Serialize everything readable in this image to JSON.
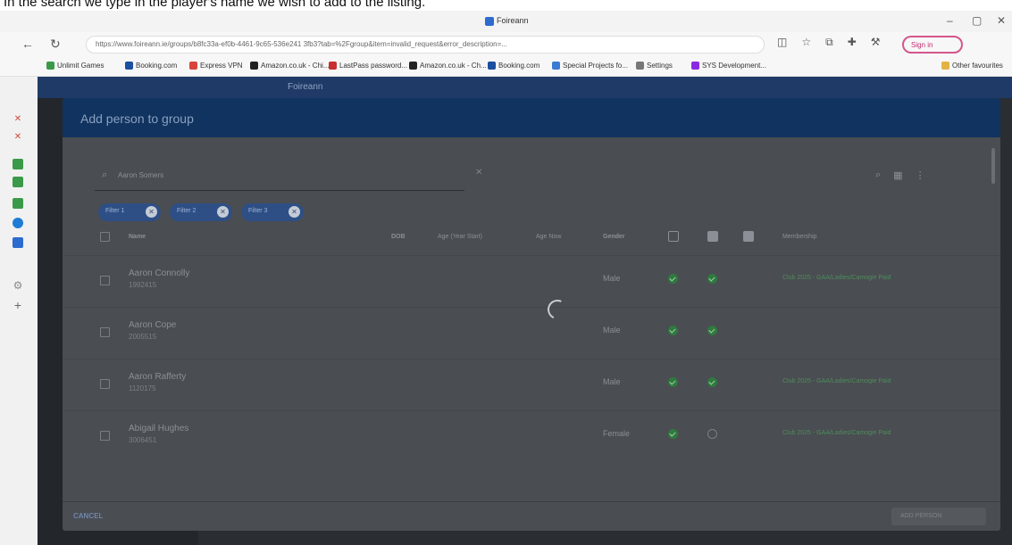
{
  "caption": "In the search we type in the player's name we wish to add to the listing.",
  "window": {
    "title": "Foireann"
  },
  "browser": {
    "url": "https://www.foireann.ie/groups/b8fc33a-ef0b-4461-9c65-536e241 3fb3?tab=%2Fgroup&item=invalid_request&error_description=...",
    "signin": "Sign in"
  },
  "bookmarks": [
    "Unlimit Games",
    "Booking.com",
    "Express VPN",
    "Amazon.co.uk - Chi...",
    "LastPass password...",
    "Amazon.co.uk - Ch...",
    "Booking.com",
    "Special Projects fo...",
    "Settings",
    "SYS Development...",
    "Other favourites"
  ],
  "app": {
    "header_title": "Foireann"
  },
  "modal": {
    "title": "Add person to group",
    "search_value": "Aaron Somers",
    "chips": [
      "Filter 1",
      "Filter 2",
      "Filter 3"
    ],
    "columns": {
      "name": "Name",
      "dob": "DOB",
      "age_club": "Age (Year Start)",
      "age_now": "Age Now",
      "gender": "Gender",
      "membership": "Membership"
    },
    "rows": [
      {
        "name": "Aaron Connolly",
        "id": "1992415",
        "gender": "Male",
        "c1": true,
        "c2": true,
        "membership": "Club 2025 - GAA/Ladies/Camogie Paid"
      },
      {
        "name": "Aaron Cope",
        "id": "2005515",
        "gender": "Male",
        "c1": true,
        "c2": true,
        "membership": ""
      },
      {
        "name": "Aaron Rafferty",
        "id": "1120175",
        "gender": "Male",
        "c1": true,
        "c2": true,
        "membership": "Club 2025 - GAA/Ladies/Camogie Paid"
      },
      {
        "name": "Abigail Hughes",
        "id": "3006451",
        "gender": "Female",
        "c1": true,
        "c2": false,
        "membership": "Club 2025 - GAA/Ladies/Camogie Paid"
      }
    ],
    "cancel": "CANCEL",
    "confirm": "ADD PERSON"
  },
  "colors": {
    "modal_header": "#11335f",
    "check": "#2f7a3e",
    "chip": "#2e4f86"
  }
}
